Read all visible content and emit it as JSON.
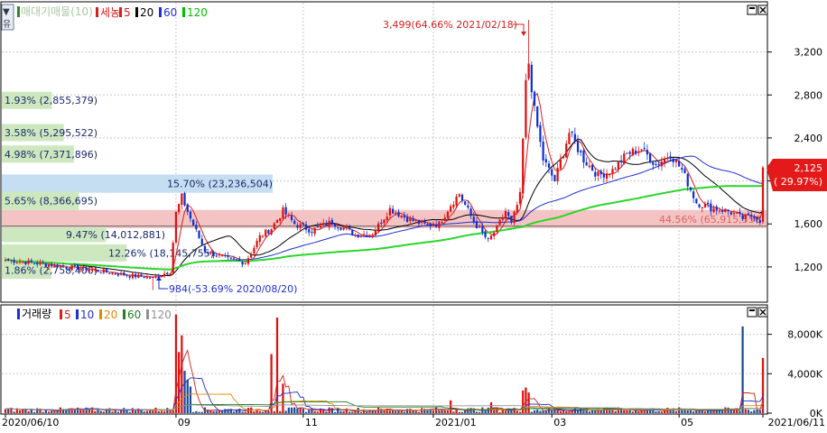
{
  "header": {
    "pane_title": "매대기매물(10)",
    "price_legend": [
      {
        "label": "세농",
        "color": "#d42020"
      },
      {
        "label": "5",
        "color": "#d42020"
      },
      {
        "label": "20",
        "color": "#000000"
      },
      {
        "label": "60",
        "color": "#1f2fd0"
      },
      {
        "label": "120",
        "color": "#00c000"
      }
    ],
    "volume_title": "거래량",
    "volume_legend": [
      {
        "label": "5",
        "color": "#d42020"
      },
      {
        "label": "10",
        "color": "#1f2fd0"
      },
      {
        "label": "20",
        "color": "#e08a00"
      },
      {
        "label": "60",
        "color": "#208020"
      },
      {
        "label": "120",
        "color": "#909090"
      }
    ],
    "left_tab_label": "유",
    "window_buttons": [
      "▫",
      "✕"
    ]
  },
  "annotations": {
    "high": "3,499(64.66% 2021/02/18)",
    "low": "984(-53.69% 2020/08/20)",
    "current_price": "2,125",
    "current_change": "( 29.97%)"
  },
  "colors": {
    "up": "#e01010",
    "down": "#1030d0",
    "ma5": "#d42020",
    "ma20": "#000000",
    "ma60": "#1f2fd0",
    "ma120": "#2ad62a",
    "vp_green": "#cde8bf",
    "vp_blue": "#c6def2",
    "vp_pink": "#f4c4c4",
    "current_band": "#f5b3b3"
  },
  "chart_data": [
    {
      "type": "candlestick",
      "title": "매대기매물(10)",
      "y_ticks": [
        "3,200",
        "2,800",
        "2,400",
        "2,000",
        "1,600",
        "1,200"
      ],
      "y_tick_values": [
        3200,
        2800,
        2400,
        2000,
        1600,
        1200
      ],
      "ylim": [
        880,
        3650
      ],
      "x_ticks": [
        "2020/06/10",
        "09",
        "11",
        "2021/01",
        "03",
        "05",
        "2021/06/11"
      ],
      "x_tick_dates": [
        "2020-06-10",
        "2020-09-01",
        "2020-11-02",
        "2021-01-04",
        "2021-03-02",
        "2021-05-03",
        "2021-06-11"
      ],
      "current_price": 2125,
      "current_change_pct": 29.97,
      "key_points": [
        {
          "date": "2021-02-18",
          "value": 3499,
          "label": "3,499(64.66% 2021/02/18)"
        },
        {
          "date": "2020-08-20",
          "value": 984,
          "label": "984(-53.69% 2020/08/20)"
        }
      ],
      "price_anchors": [
        [
          "2020-06-10",
          1265
        ],
        [
          "2020-06-30",
          1225
        ],
        [
          "2020-07-20",
          1180
        ],
        [
          "2020-08-10",
          1120
        ],
        [
          "2020-08-20",
          1100
        ],
        [
          "2020-08-28",
          1160
        ],
        [
          "2020-09-01",
          1700
        ],
        [
          "2020-09-03",
          1850
        ],
        [
          "2020-09-08",
          1650
        ],
        [
          "2020-09-15",
          1350
        ],
        [
          "2020-09-25",
          1270
        ],
        [
          "2020-10-05",
          1240
        ],
        [
          "2020-10-12",
          1480
        ],
        [
          "2020-10-16",
          1560
        ],
        [
          "2020-10-22",
          1720
        ],
        [
          "2020-10-28",
          1600
        ],
        [
          "2020-11-05",
          1540
        ],
        [
          "2020-11-16",
          1620
        ],
        [
          "2020-11-26",
          1500
        ],
        [
          "2020-12-04",
          1510
        ],
        [
          "2020-12-14",
          1740
        ],
        [
          "2020-12-22",
          1650
        ],
        [
          "2020-12-30",
          1590
        ],
        [
          "2021-01-06",
          1600
        ],
        [
          "2021-01-12",
          1780
        ],
        [
          "2021-01-15",
          1880
        ],
        [
          "2021-01-22",
          1620
        ],
        [
          "2021-01-29",
          1440
        ],
        [
          "2021-02-03",
          1560
        ],
        [
          "2021-02-08",
          1720
        ],
        [
          "2021-02-10",
          1600
        ],
        [
          "2021-02-15",
          1860
        ],
        [
          "2021-02-17",
          2900
        ],
        [
          "2021-02-18",
          3100
        ],
        [
          "2021-02-22",
          2650
        ],
        [
          "2021-02-25",
          2200
        ],
        [
          "2021-03-03",
          2000
        ],
        [
          "2021-03-10",
          2450
        ],
        [
          "2021-03-17",
          2200
        ],
        [
          "2021-03-24",
          2050
        ],
        [
          "2021-03-31",
          2100
        ],
        [
          "2021-04-07",
          2250
        ],
        [
          "2021-04-14",
          2300
        ],
        [
          "2021-04-21",
          2150
        ],
        [
          "2021-04-28",
          2250
        ],
        [
          "2021-05-04",
          2100
        ],
        [
          "2021-05-11",
          1800
        ],
        [
          "2021-05-18",
          1750
        ],
        [
          "2021-05-26",
          1720
        ],
        [
          "2021-06-02",
          1650
        ],
        [
          "2021-06-08",
          1680
        ],
        [
          "2021-06-10",
          1635
        ],
        [
          "2021-06-11",
          2125
        ]
      ],
      "volume_profile": [
        {
          "label": "1.93% (2,855,379)",
          "price_low": 2670,
          "price_high": 2830,
          "length_pct": 1.93,
          "color": "vp_green"
        },
        {
          "label": "3.58% (5,295,522)",
          "price_low": 2370,
          "price_high": 2530,
          "length_pct": 3.58,
          "color": "vp_green"
        },
        {
          "label": "4.98% (7,371,896)",
          "price_low": 2170,
          "price_high": 2330,
          "length_pct": 4.98,
          "color": "vp_green"
        },
        {
          "label": "15.70% (23,236,504)",
          "price_low": 1890,
          "price_high": 2060,
          "length_pct": 15.7,
          "color": "vp_blue"
        },
        {
          "label": "5.65% (8,366,695)",
          "price_low": 1730,
          "price_high": 1900,
          "length_pct": 5.65,
          "color": "vp_green"
        },
        {
          "label": "44.56% (65,915,556)",
          "price_low": 1560,
          "price_high": 1730,
          "length_pct": 44.56,
          "color": "vp_pink"
        },
        {
          "label": "9.47% (14,012,881)",
          "price_low": 1430,
          "price_high": 1570,
          "length_pct": 9.47,
          "color": "vp_green"
        },
        {
          "label": "12.26% (18,145,755)",
          "price_low": 1250,
          "price_high": 1410,
          "length_pct": 12.26,
          "color": "vp_green"
        },
        {
          "label": "1.86% (2,758,400)",
          "price_low": 1090,
          "price_high": 1250,
          "length_pct": 1.86,
          "color": "vp_green"
        }
      ]
    },
    {
      "type": "bar",
      "title": "거래량",
      "y_ticks": [
        "8,000K",
        "4,000K",
        "0K"
      ],
      "y_tick_values": [
        8000,
        4000,
        0
      ],
      "ylabel_unit": "K",
      "ylim": [
        0,
        10800
      ],
      "spikes": [
        {
          "date": "2020-09-01",
          "value": 10000
        },
        {
          "date": "2020-09-02",
          "value": 6200
        },
        {
          "date": "2020-09-03",
          "value": 7900
        },
        {
          "date": "2020-09-04",
          "value": 4300
        },
        {
          "date": "2020-09-07",
          "value": 3400
        },
        {
          "date": "2020-09-08",
          "value": 2700
        },
        {
          "date": "2020-10-16",
          "value": 6000
        },
        {
          "date": "2020-10-20",
          "value": 9700
        },
        {
          "date": "2020-10-22",
          "value": 3000
        },
        {
          "date": "2021-01-12",
          "value": 1300
        },
        {
          "date": "2021-02-01",
          "value": 1100
        },
        {
          "date": "2021-02-16",
          "value": 2300
        },
        {
          "date": "2021-02-17",
          "value": 2600
        },
        {
          "date": "2021-02-18",
          "value": 2100
        },
        {
          "date": "2021-06-02",
          "value": 8800
        },
        {
          "date": "2021-06-11",
          "value": 5600
        }
      ],
      "baseline_volume": 350
    }
  ]
}
